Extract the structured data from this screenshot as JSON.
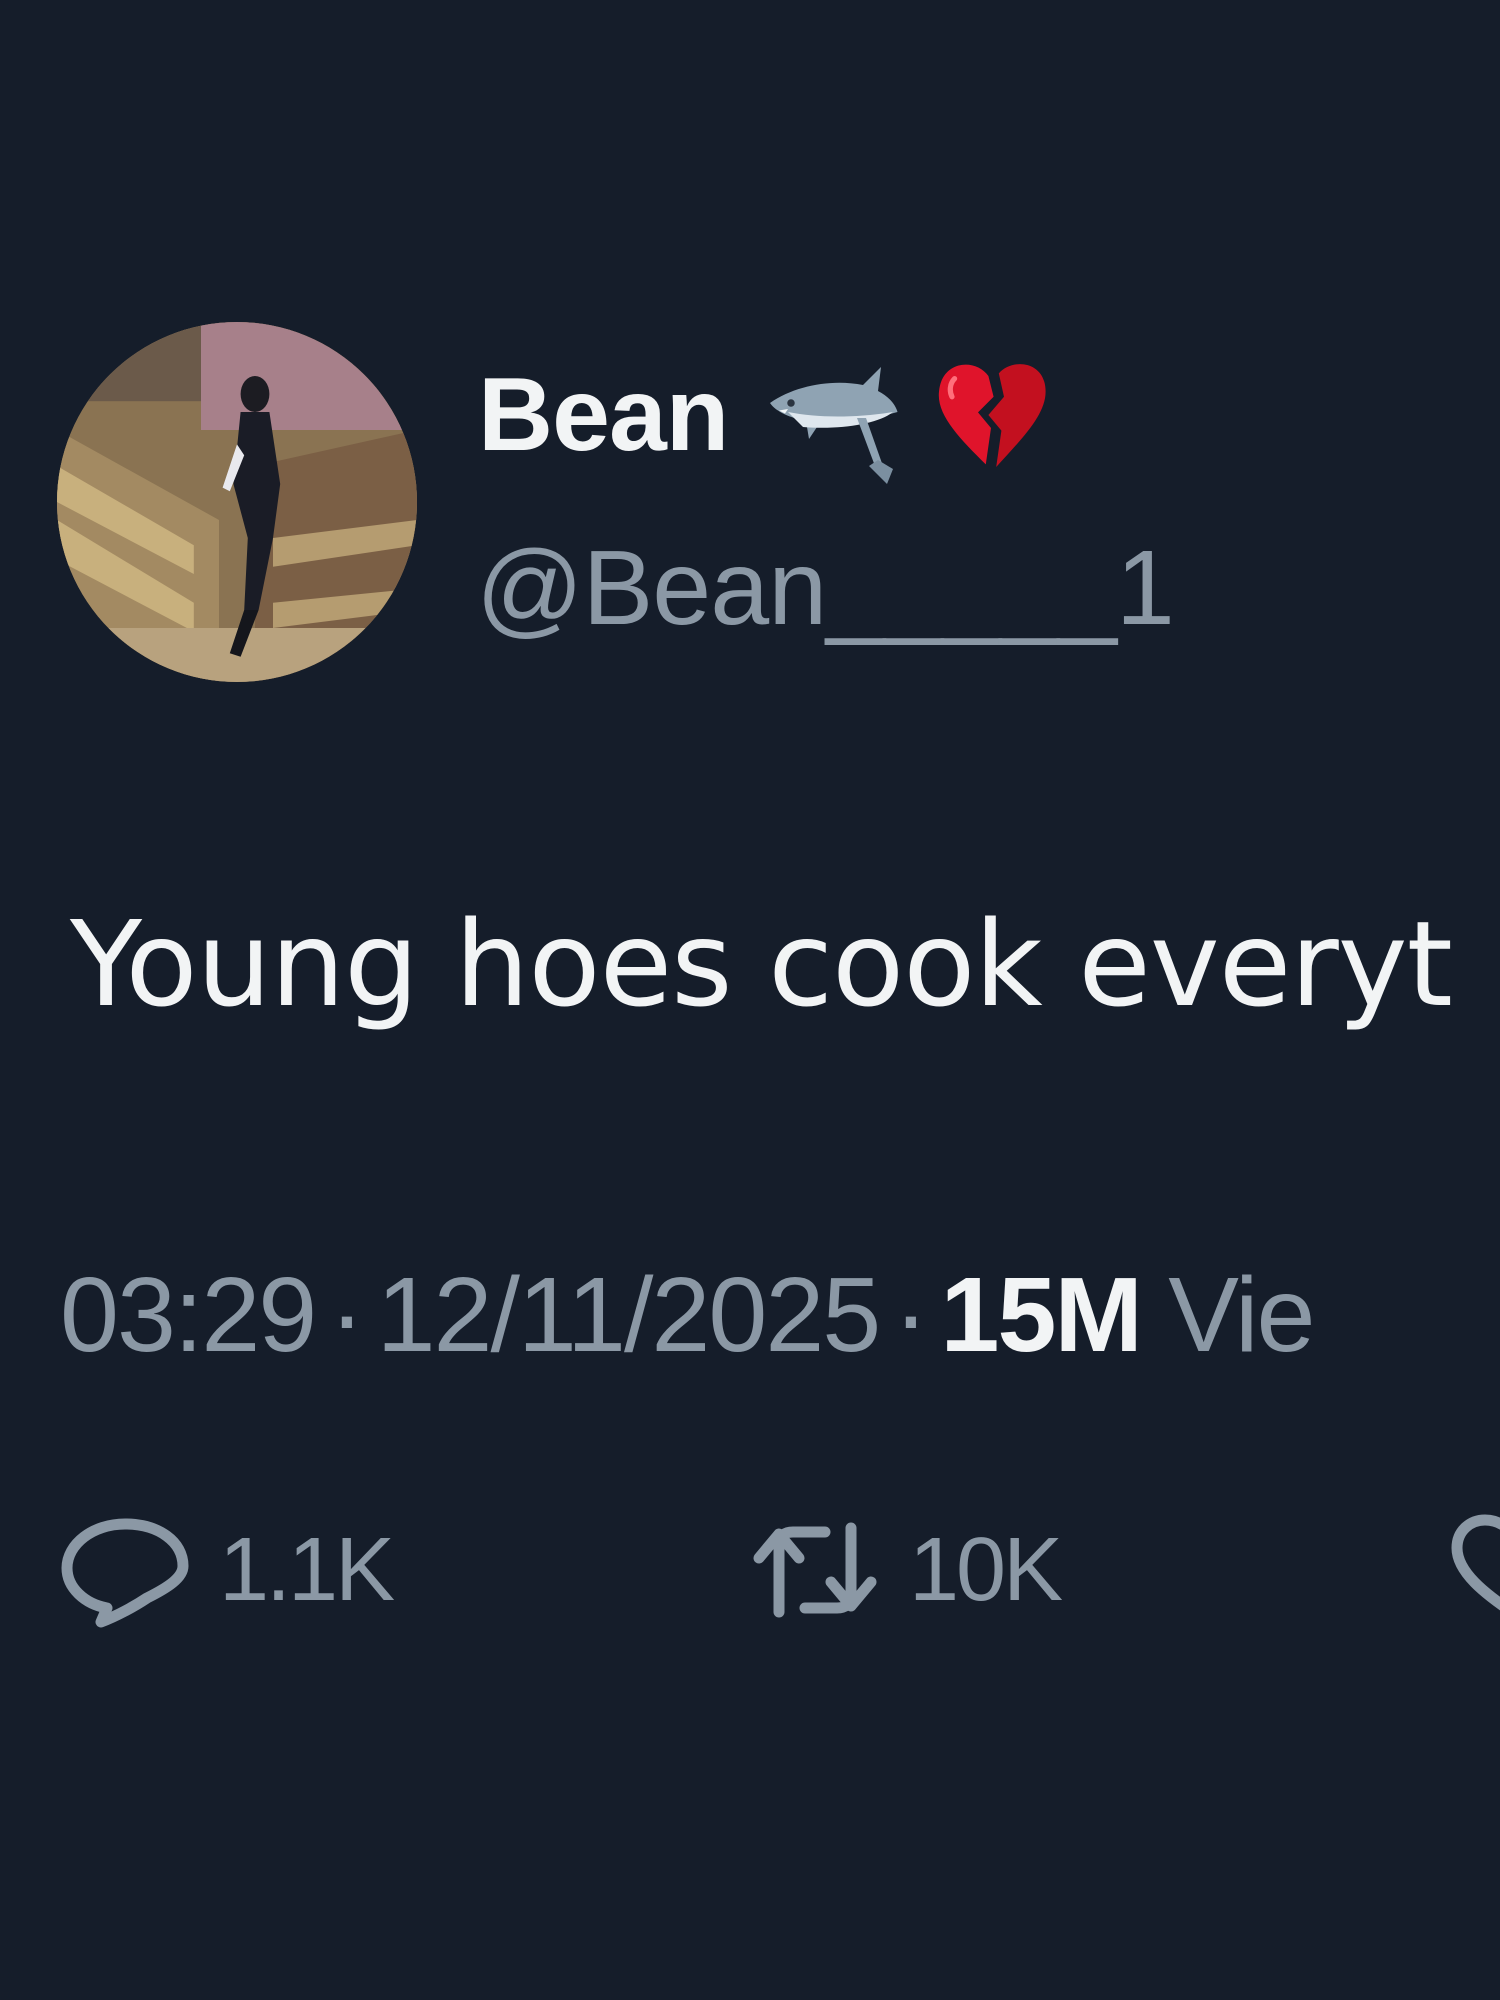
{
  "tweet": {
    "display_name": "Bean",
    "name_emojis": [
      "shark-emoji",
      "broken-heart-emoji"
    ],
    "handle": "@Bean_____1",
    "text": "Young hoes cook everyt",
    "time": "03:29",
    "separator": "·",
    "date": "12/11/2025",
    "views_count": "15M",
    "views_label": "Vie"
  },
  "actions": {
    "reply_icon": "reply-icon",
    "reply_count": "1.1K",
    "retweet_icon": "retweet-icon",
    "retweet_count": "10K",
    "like_icon": "like-icon"
  },
  "colors": {
    "background": "#151d2a",
    "primary_text": "#f2f4f5",
    "secondary_text": "#8b98a5"
  }
}
